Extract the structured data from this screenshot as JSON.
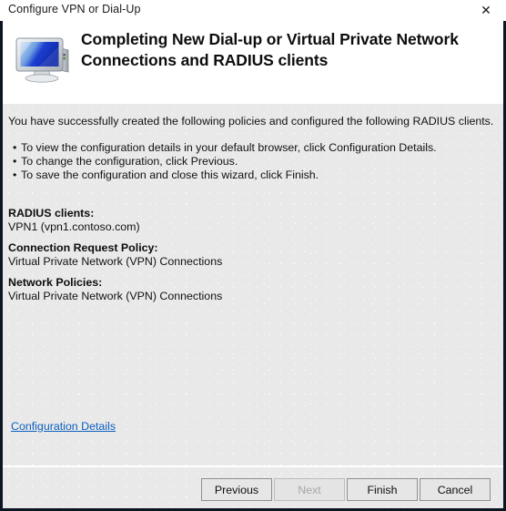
{
  "window": {
    "title": "Configure VPN or Dial-Up",
    "close_label": "✕"
  },
  "header": {
    "icon": "computer-monitor-icon",
    "title": "Completing New Dial-up or Virtual Private Network Connections and RADIUS clients"
  },
  "body": {
    "intro": "You have successfully created the following policies and configured the following RADIUS clients.",
    "bullets": [
      "To view the configuration details in your default browser, click Configuration Details.",
      "To change the configuration, click Previous.",
      "To save the configuration and close this wizard, click Finish."
    ],
    "sections": [
      {
        "label": "RADIUS clients:",
        "value": "VPN1 (vpn1.contoso.com)"
      },
      {
        "label": "Connection Request Policy:",
        "value": "Virtual Private Network (VPN) Connections"
      },
      {
        "label": "Network Policies:",
        "value": "Virtual Private Network (VPN) Connections"
      }
    ],
    "config_link": "Configuration Details"
  },
  "buttons": {
    "previous": "Previous",
    "next": "Next",
    "finish": "Finish",
    "cancel": "Cancel"
  },
  "colors": {
    "link": "#0b5fbd",
    "body_background": "#e9e9ea",
    "frame": "#0b1622",
    "disabled_text": "#a6a6a6"
  }
}
